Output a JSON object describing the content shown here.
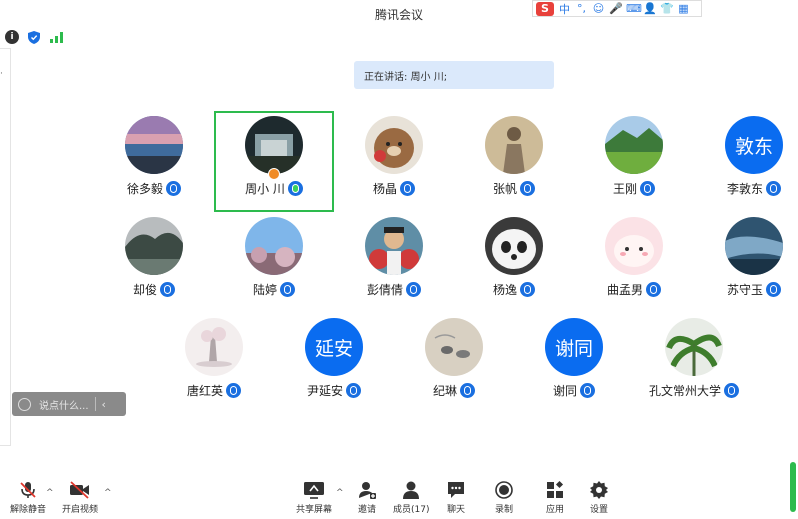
{
  "window": {
    "title": "腾讯会议"
  },
  "ime": {
    "logo": "S",
    "items": [
      "中",
      "°,",
      "☺",
      "🎤",
      "⌨",
      "👤",
      "👕",
      "▦"
    ]
  },
  "status_icons": {
    "info": "i",
    "shield": "shield-icon",
    "signal": "signal-icon"
  },
  "speaking": {
    "text": "正在讲话: 周小 川;"
  },
  "participants": [
    {
      "name": "徐多毅",
      "avatar_text": ""
    },
    {
      "name": "周小 川",
      "avatar_text": ""
    },
    {
      "name": "杨晶",
      "avatar_text": ""
    },
    {
      "name": "张帆",
      "avatar_text": ""
    },
    {
      "name": "王刚",
      "avatar_text": ""
    },
    {
      "name": "李敦东",
      "avatar_text": "敦东"
    },
    {
      "name": "却俊",
      "avatar_text": ""
    },
    {
      "name": "陆婷",
      "avatar_text": ""
    },
    {
      "name": "彭倩倩",
      "avatar_text": ""
    },
    {
      "name": "杨逸",
      "avatar_text": ""
    },
    {
      "name": "曲孟男",
      "avatar_text": ""
    },
    {
      "name": "苏守玉",
      "avatar_text": ""
    },
    {
      "name": "唐红英",
      "avatar_text": ""
    },
    {
      "name": "尹延安",
      "avatar_text": "延安"
    },
    {
      "name": "纪琳",
      "avatar_text": ""
    },
    {
      "name": "谢同",
      "avatar_text": "谢同"
    },
    {
      "name": "孔文常州大学",
      "avatar_text": ""
    }
  ],
  "chat": {
    "placeholder": "说点什么..."
  },
  "toolbar": {
    "unmute": "解除静音",
    "start_video": "开启视频",
    "share_screen": "共享屏幕",
    "invite": "邀请",
    "members": "成员(17)",
    "chat": "聊天",
    "record": "录制",
    "apps": "应用",
    "settings": "设置"
  },
  "colors": {
    "accent": "#1a6fe0",
    "active_speaker": "#2dbb4d",
    "speaking_bg": "#dbe9fb"
  }
}
